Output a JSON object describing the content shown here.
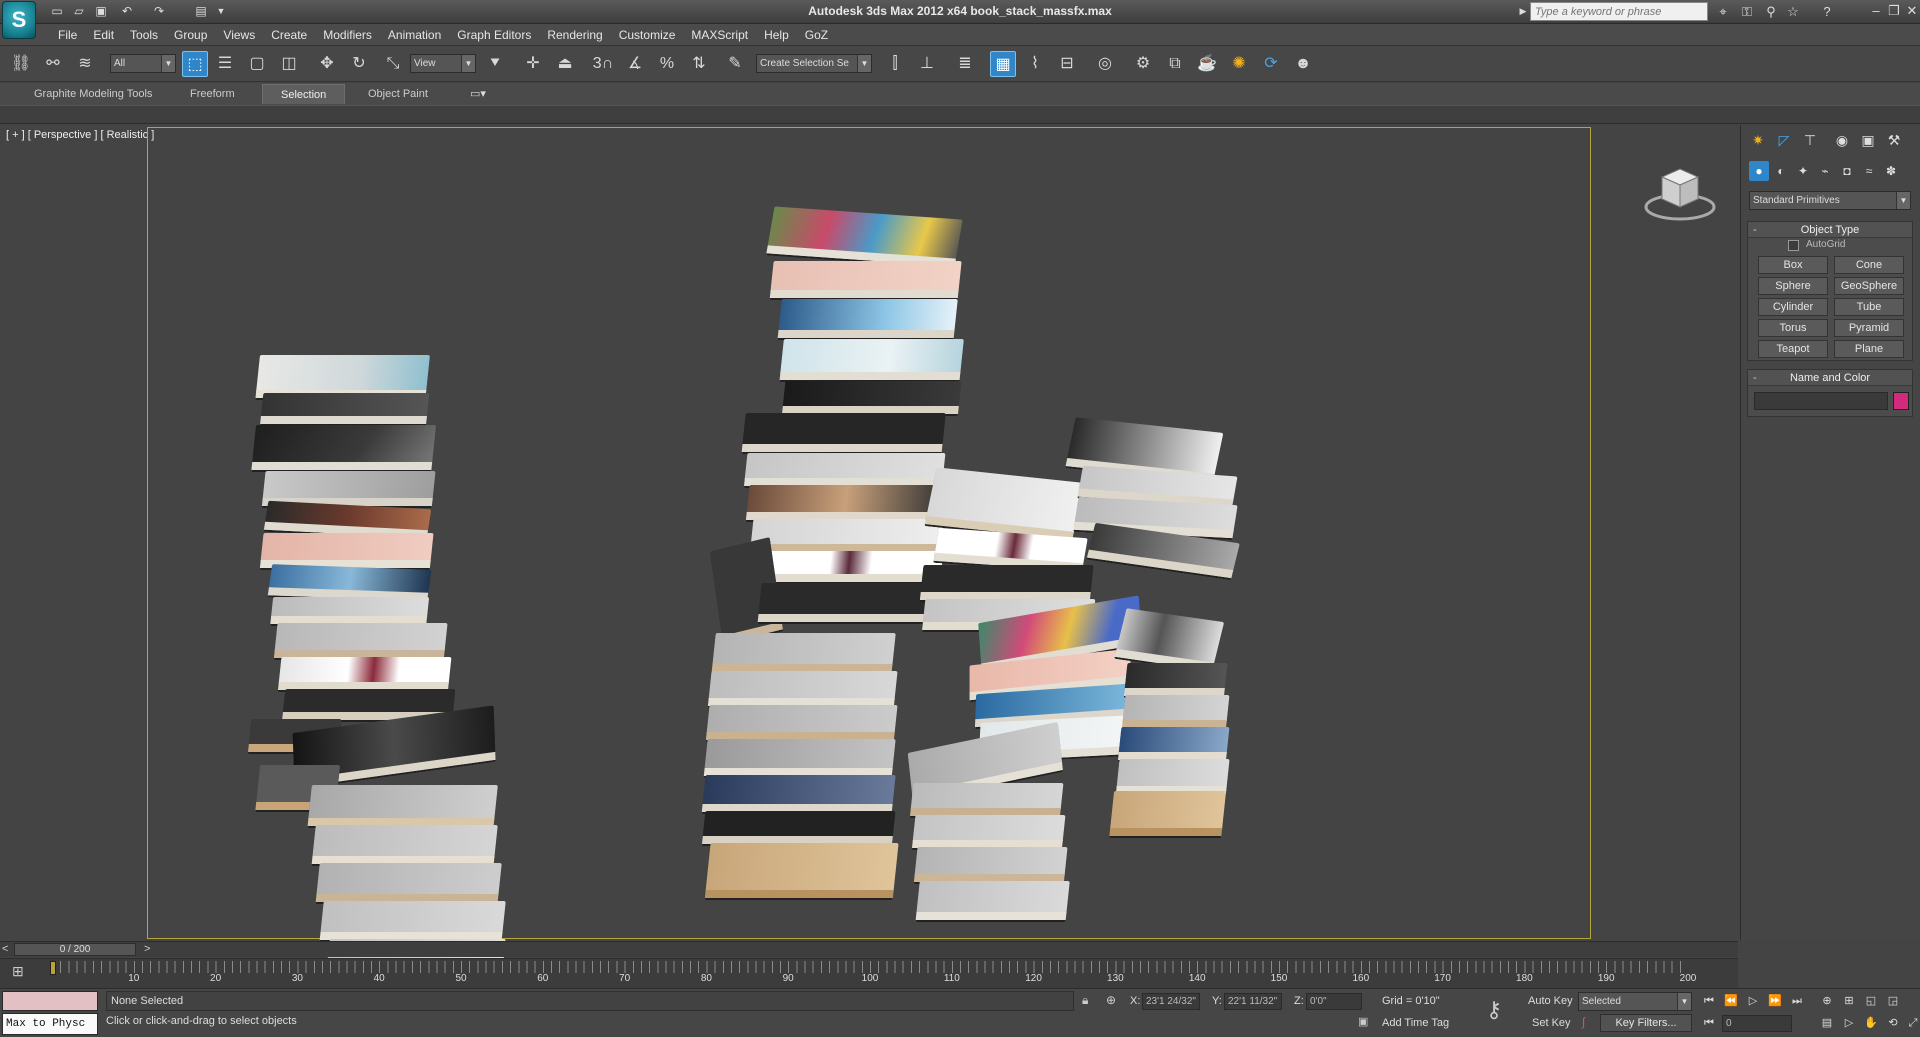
{
  "window": {
    "title": "Autodesk 3ds Max  2012 x64     book_stack_massfx.max",
    "search_placeholder": "Type a keyword or phrase"
  },
  "menu": [
    "File",
    "Edit",
    "Tools",
    "Group",
    "Views",
    "Create",
    "Modifiers",
    "Animation",
    "Graph Editors",
    "Rendering",
    "Customize",
    "MAXScript",
    "Help",
    "GoZ"
  ],
  "toolbar": {
    "selection_filter": "All",
    "reference_coord": "View",
    "named_selection": "Create Selection Se",
    "snap_label": "3"
  },
  "ribbon": {
    "tabs": [
      "Graphite Modeling Tools",
      "Freeform",
      "Selection",
      "Object Paint"
    ],
    "active_tab": "Selection"
  },
  "viewport": {
    "label": "[ + ] [ Perspective ] [ Realistic ]"
  },
  "command_panel": {
    "category": "Standard Primitives",
    "object_type_title": "Object Type",
    "autogrid_label": "AutoGrid",
    "object_buttons": [
      "Box",
      "Cone",
      "Sphere",
      "GeoSphere",
      "Cylinder",
      "Tube",
      "Torus",
      "Pyramid",
      "Teapot",
      "Plane"
    ],
    "name_color_title": "Name and Color",
    "object_color": "#d42a7c"
  },
  "timeline": {
    "frame_label": "0 / 200",
    "ticks": [
      "10",
      "20",
      "30",
      "40",
      "50",
      "60",
      "70",
      "80",
      "90",
      "100",
      "110",
      "120",
      "130",
      "140",
      "150",
      "160",
      "170",
      "180",
      "190",
      "200"
    ]
  },
  "status": {
    "script_listener": "Max to Physc",
    "selection_status": "None Selected",
    "prompt": "Click or click-and-drag to select objects",
    "x_label": "X:",
    "x_value": "23'1 24/32\"",
    "y_label": "Y:",
    "y_value": "22'1 11/32\"",
    "z_label": "Z:",
    "z_value": "0'0\"",
    "grid": "Grid = 0'10\"",
    "add_time_tag": "Add Time Tag",
    "auto_key": "Auto Key",
    "auto_key_mode": "Selected",
    "set_key": "Set Key",
    "key_filters": "Key Filters...",
    "current_frame": "0"
  }
}
